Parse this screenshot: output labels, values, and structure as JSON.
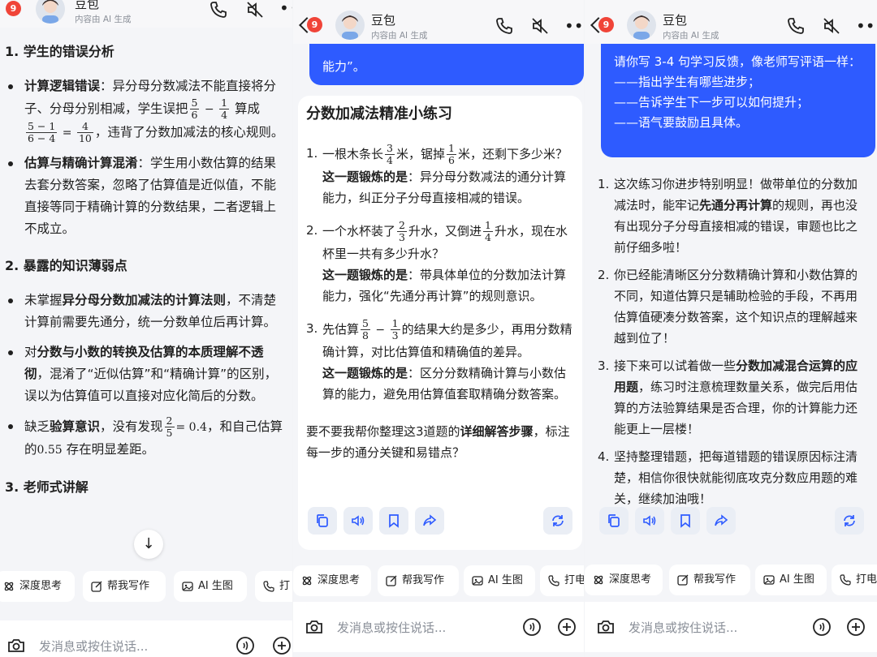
{
  "header": {
    "badge_count": "9",
    "name": "豆包",
    "subtitle": "内容由 AI 生成"
  },
  "panel1": {
    "section1_title": "1. 学生的错误分析",
    "b1_label": "计算逻辑错误",
    "b1_text_a": "：异分母分数减法不能直接将分子、分母分别相减，学生误把",
    "b1_text_b": "算成",
    "b1_text_c": "，违背了分数加减法的核心规则。",
    "b2_label": "估算与精确计算混淆",
    "b2_text": "：学生用小数估算的结果去套分数答案，忽略了估算值是近似值，不能直接等同于精确计算的分数结果，二者逻辑上不成立。",
    "section2_title": "2. 暴露的知识薄弱点",
    "b3_pre": "未掌握",
    "b3_bold": "异分母分数加减法的计算法则",
    "b3_post": "，不清楚计算前需要先通分，统一分数单位后再计算。",
    "b4_pre": "对",
    "b4_bold": "分数与小数的转换及估算的本质理解不透彻",
    "b4_post": "，混淆了“近似估算”和“精确计算”的区别，误以为估算值可以直接对应化简后的分数。",
    "b5_pre": "缺乏",
    "b5_bold": "验算意识",
    "b5_mid": "，没有发现",
    "b5_eq": "= 0.4",
    "b5_post": "，和自己估算的",
    "b5_val": "0.55",
    "b5_end": "存在明显差距。",
    "section3_title": "3. 老师式讲解"
  },
  "panel2": {
    "bubble_top": "能力”。",
    "title": "分数加减法精准小练习",
    "q1_a": "一根木条长",
    "q1_b": "米，锯掉",
    "q1_c": "米，还剩下多少米？",
    "q1_label": "这一题锻炼的是",
    "q1_text": "：异分母分数减法的通分计算能力，纠正分子分母直接相减的错误。",
    "q2_a": "一个水杯装了",
    "q2_b": "升水，又倒进",
    "q2_c": "升水，现在水杯里一共有多少升水？",
    "q2_label": "这一题锻炼的是",
    "q2_text": "：带具体单位的分数加法计算能力，强化“先通分再计算”的规则意识。",
    "q3_a": "先估算",
    "q3_b": "的结果大约是多少，再用分数精确计算，对比估算值和精确值的差异。",
    "q3_label": "这一题锻炼的是",
    "q3_text": "：区分分数精确计算与小数估算的能力，避免用估算值套取精确分数答案。",
    "closing_pre": "要不要我帮你整理这3道题的",
    "closing_bold": "详细解答步骤",
    "closing_post": "，标注每一步的通分关键和易错点？"
  },
  "panel3": {
    "bubble_lines": [
      "请你写 3-4 句学习反馈，像老师写评语一样：",
      "——指出学生有哪些进步；",
      "——告诉学生下一步可以如何提升；",
      "——语气要鼓励且具体。"
    ],
    "p1_a": "这次练习你进步特别明显！做带单位的分数加减法时，能牢记",
    "p1_bold": "先通分再计算",
    "p1_b": "的规则，再也没有出现分子分母直接相减的错误，审题也比之前仔细多啦！",
    "p2": "你已经能清晰区分分数精确计算和小数估算的不同，知道估算只是辅助检验的手段，不再用估算值硬凑分数答案，这个知识点的理解越来越到位了！",
    "p3_a": "接下来可以试着做一些",
    "p3_bold": "分数加减混合运算的应用题",
    "p3_b": "，练习时注意梳理数量关系，做完后用估算的方法验算结果是否合理，你的计算能力还能更上一层楼！",
    "p4": "坚持整理错题，把每道错题的错误原因标注清楚，相信你很快就能彻底攻克分数应用题的难关，继续加油哦！"
  },
  "chips": {
    "deep_think": "深度思考",
    "help_write": "帮我写作",
    "ai_image": "AI 生图",
    "call": "打电"
  },
  "chips_p1_call": "打",
  "input": {
    "placeholder": "发消息或按住说话..."
  },
  "colors": {
    "accent": "#2e5bff",
    "badge": "#f04438",
    "background": "#f4f5f8"
  }
}
